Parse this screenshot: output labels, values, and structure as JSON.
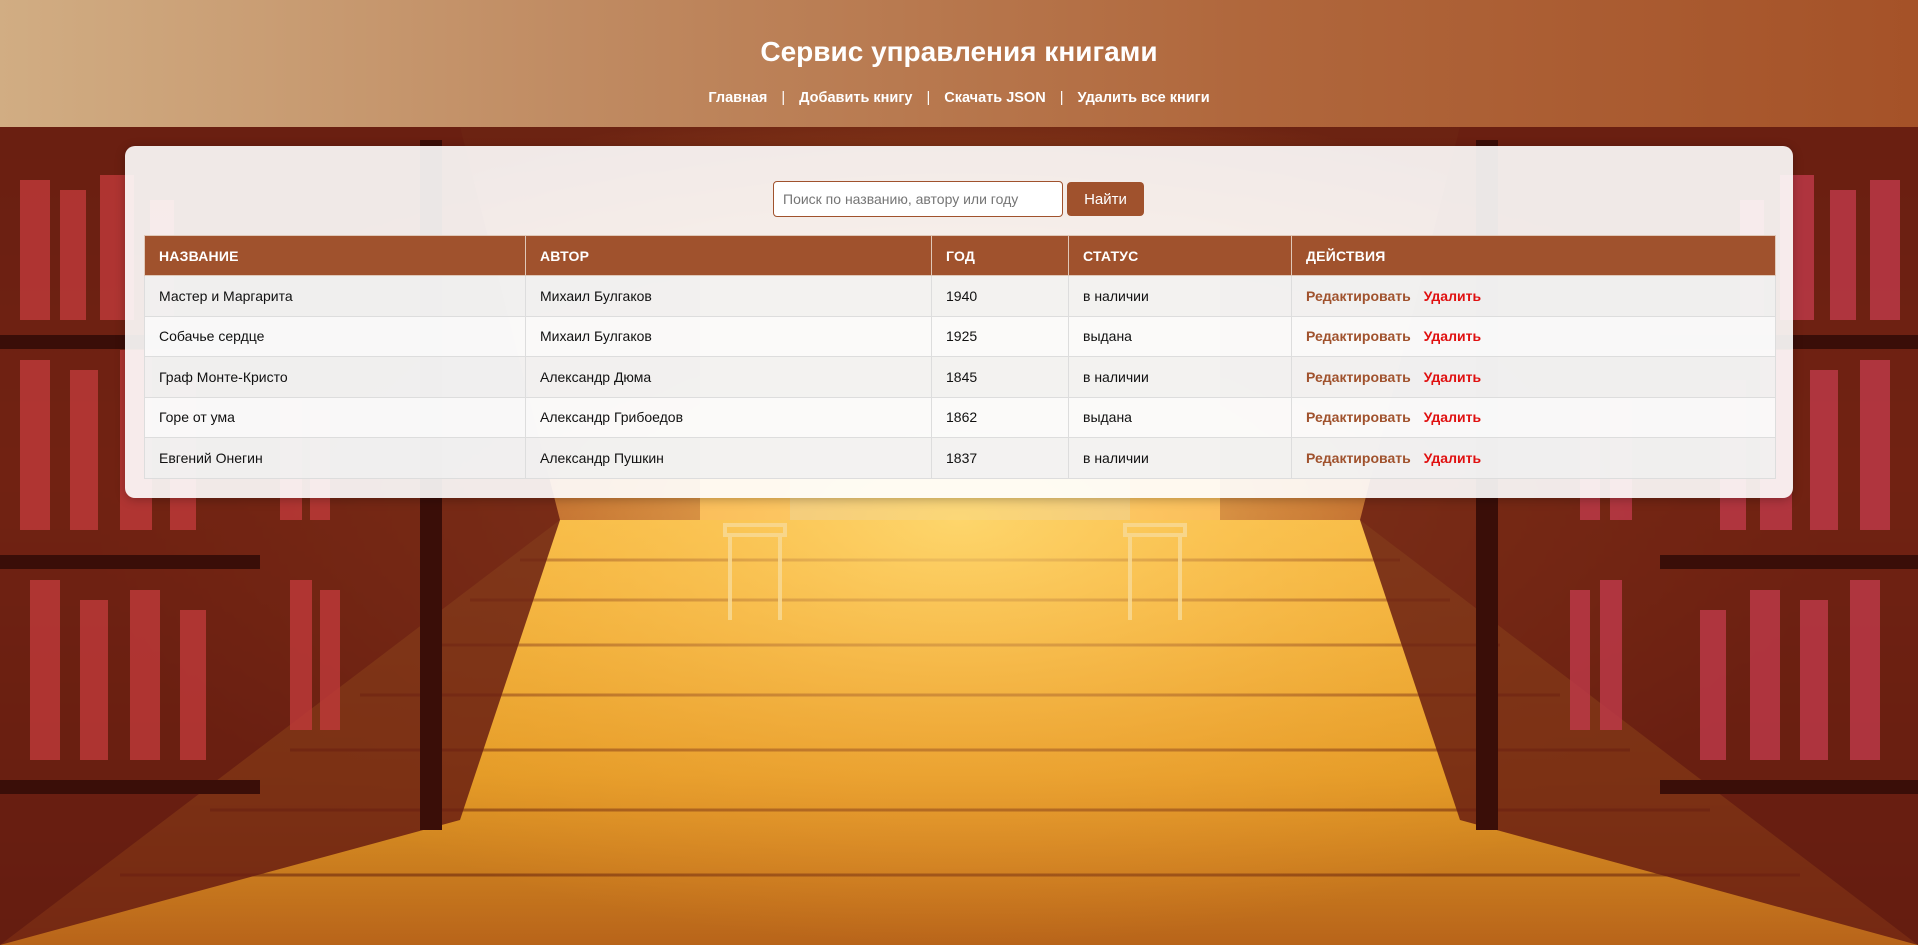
{
  "header": {
    "title": "Сервис управления книгами",
    "nav": [
      {
        "label": "Главная"
      },
      {
        "label": "Добавить книгу"
      },
      {
        "label": "Скачать JSON"
      },
      {
        "label": "Удалить все книги"
      }
    ],
    "separator": "|"
  },
  "search": {
    "placeholder": "Поиск по названию, автору или году",
    "value": "",
    "button_label": "Найти"
  },
  "table": {
    "columns": [
      "НАЗВАНИЕ",
      "АВТОР",
      "ГОД",
      "СТАТУС",
      "ДЕЙСТВИЯ"
    ],
    "rows": [
      {
        "title": "Мастер и Маргарита",
        "author": "Михаил Булгаков",
        "year": "1940",
        "status": "в наличии",
        "edit": "Редактировать",
        "delete": "Удалить"
      },
      {
        "title": "Собачье сердце",
        "author": "Михаил Булгаков",
        "year": "1925",
        "status": "выдана",
        "edit": "Редактировать",
        "delete": "Удалить"
      },
      {
        "title": "Граф Монте-Кристо",
        "author": "Александр Дюма",
        "year": "1845",
        "status": "в наличии",
        "edit": "Редактировать",
        "delete": "Удалить"
      },
      {
        "title": "Горе от ума",
        "author": "Александр Грибоедов",
        "year": "1862",
        "status": "выдана",
        "edit": "Редактировать",
        "delete": "Удалить"
      },
      {
        "title": "Евгений Онегин",
        "author": "Александр Пушкин",
        "year": "1837",
        "status": "в наличии",
        "edit": "Редактировать",
        "delete": "Удалить"
      }
    ]
  },
  "colors": {
    "accent": "#a0522d",
    "delete": "#e01010",
    "header_gradient_start": "#d1ad83",
    "header_gradient_end": "#a55228"
  },
  "background": {
    "icon": "library-illustration"
  }
}
